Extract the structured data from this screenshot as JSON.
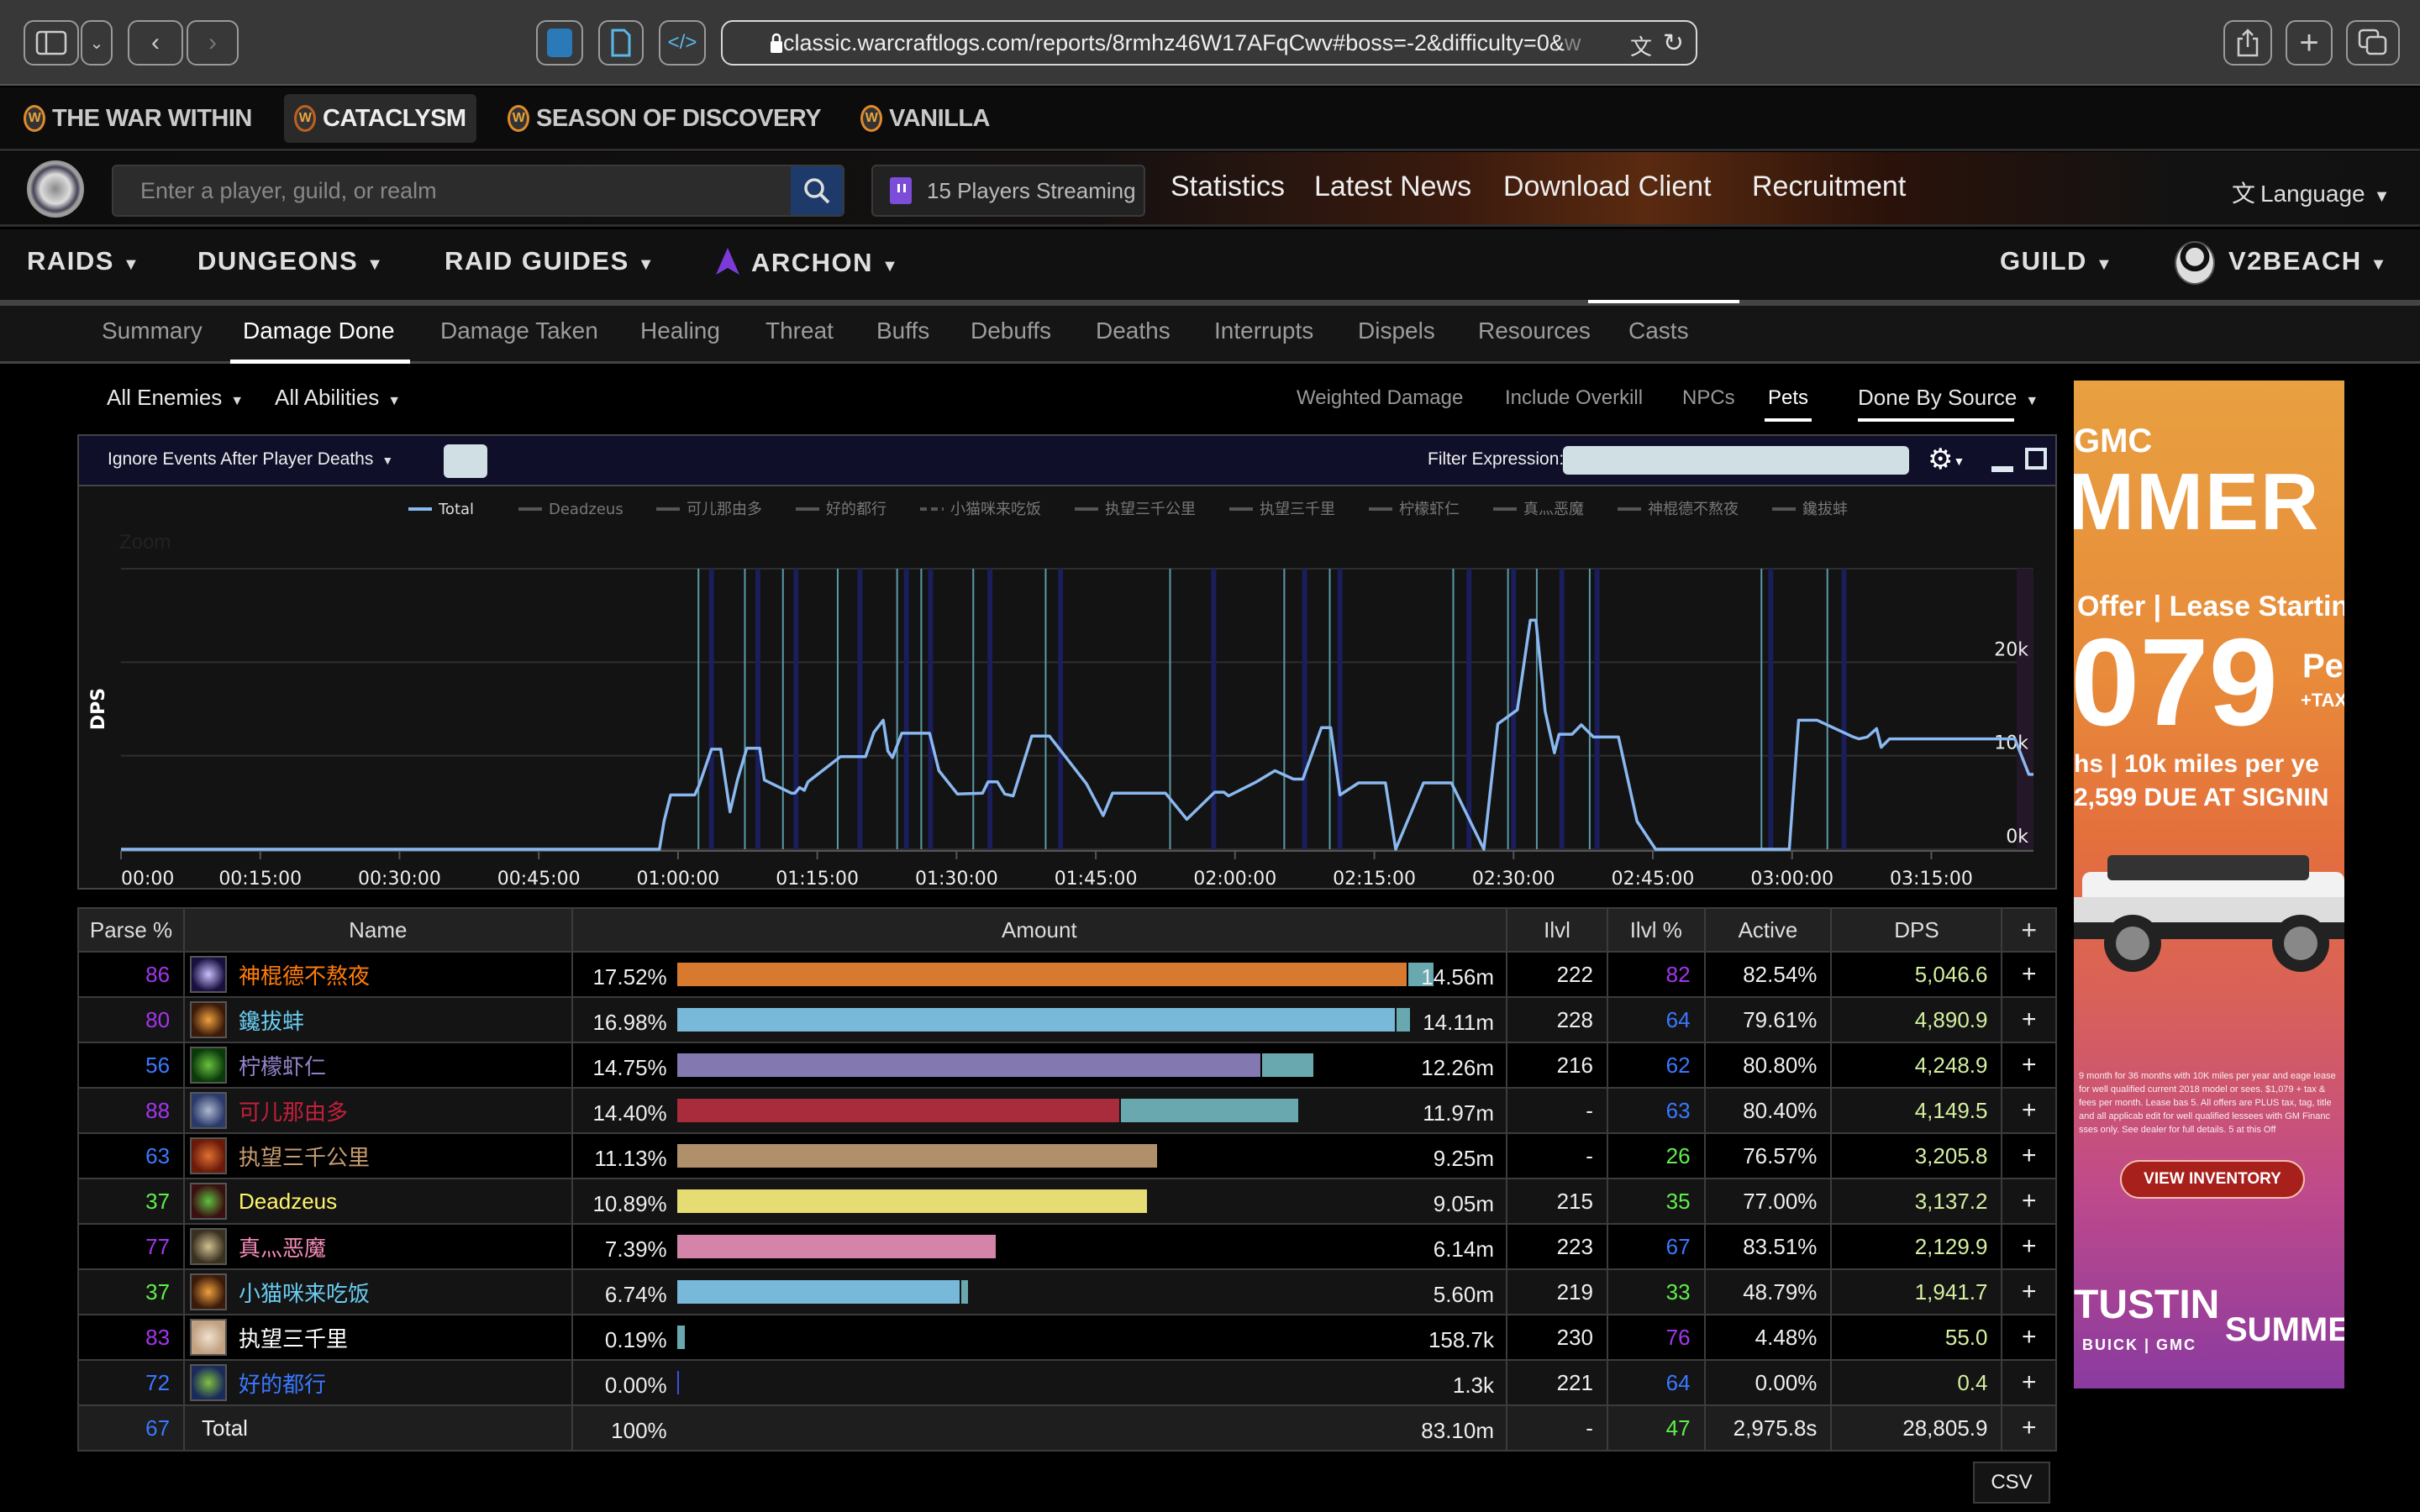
{
  "browser": {
    "url_main": "classic.warcraftlogs.com/reports/8rmhz46W17AFqCwv#boss=-2&difficulty=0&",
    "url_fade": "w",
    "buttons": [
      "sidebar-toggle",
      "tab-overview",
      "back",
      "forward",
      "extension-1",
      "reader",
      "developer",
      "share",
      "new-tab",
      "tab-overview-grid"
    ]
  },
  "game_tabs": [
    {
      "label": "THE WAR WITHIN",
      "active": false
    },
    {
      "label": "CATACLYSM",
      "active": true
    },
    {
      "label": "SEASON OF DISCOVERY",
      "active": false
    },
    {
      "label": "VANILLA",
      "active": false
    }
  ],
  "header": {
    "search_placeholder": "Enter a player, guild, or realm",
    "streaming": "15 Players Streaming",
    "links": [
      "Statistics",
      "Latest News",
      "Download Client",
      "Recruitment"
    ],
    "language": "Language"
  },
  "main_nav": {
    "left": [
      "RAIDS",
      "DUNGEONS",
      "RAID GUIDES",
      "ARCHON"
    ],
    "guild": "GUILD",
    "user": "V2BEACH"
  },
  "report_tabs": {
    "items": [
      "Summary",
      "Damage Done",
      "Damage Taken",
      "Healing",
      "Threat",
      "Buffs",
      "Debuffs",
      "Deaths",
      "Interrupts",
      "Dispels",
      "Resources",
      "Casts"
    ],
    "active": "Damage Done"
  },
  "filters": {
    "enemies": "All Enemies",
    "abilities": "All Abilities",
    "options": [
      {
        "label": "Weighted Damage",
        "active": false
      },
      {
        "label": "Include Overkill",
        "active": false
      },
      {
        "label": "NPCs",
        "active": false
      },
      {
        "label": "Pets",
        "active": true
      }
    ],
    "view": "Done By Source",
    "ignore_events": "Ignore Events After Player Deaths",
    "filter_expression_label": "Filter Expression:",
    "filter_expression_value": ""
  },
  "chart_data": {
    "type": "line",
    "title": "",
    "zoom_label": "Zoom",
    "ylabel": "DPS",
    "xlabel": "",
    "ylim": [
      0,
      24000
    ],
    "yticks": [
      "0k",
      "10k",
      "20k"
    ],
    "ytick_values": [
      0,
      10000,
      20000
    ],
    "xticks": [
      "00:00",
      "00:15:00",
      "00:30:00",
      "00:45:00",
      "01:00:00",
      "01:15:00",
      "01:30:00",
      "01:45:00",
      "02:00:00",
      "02:15:00",
      "02:30:00",
      "02:45:00",
      "03:00:00",
      "03:15:00"
    ],
    "x_range_minutes": [
      0,
      206
    ],
    "legend": [
      "Total",
      "Deadzeus",
      "可儿那由多",
      "好的都行",
      "小猫咪来吃饭",
      "执望三千公里",
      "执望三千里",
      "柠檬虾仁",
      "真灬恶魔",
      "神棍德不熬夜",
      "鑱拔蚌"
    ],
    "legend_active": "Total",
    "legend_placement": "top-center",
    "grid": true,
    "series": [
      {
        "name": "Total",
        "color": "#8ab8f0",
        "x_minutes": [
          0,
          58,
          58.5,
          59.2,
          61.5,
          61.8,
          62.3,
          63.6,
          64.1,
          64.6,
          65.6,
          66.4,
          67.4,
          68.8,
          69.3,
          72.2,
          72.6,
          73.1,
          73.6,
          74,
          77.5,
          78,
          80.2,
          81.1,
          82.1,
          82.6,
          83.1,
          84.1,
          85.1,
          87.1,
          88.1,
          90.1,
          92.8,
          93.4,
          94.4,
          95.2,
          96.1,
          98.1,
          99.1,
          100,
          104,
          105.8,
          106.8,
          107.6,
          112.5,
          114.8,
          117.8,
          118.8,
          119.3,
          122.3,
          124.3,
          126.3,
          127.3,
          129.3,
          130.3,
          131.3,
          133.3,
          136.2,
          137.3,
          140.3,
          141.2,
          143.3,
          146.8,
          148.3,
          150.4,
          151.8,
          152.4,
          153.4,
          154.4,
          154.9,
          156.3,
          157.3,
          158.6,
          159.3,
          161.3,
          163.3,
          165.3,
          166.8,
          173.3,
          179.7,
          180.7,
          182.7,
          186.6,
          187.2,
          188.1,
          189.1,
          189.6,
          190.5,
          191.7,
          195.8,
          196.2,
          198.3,
          199.3,
          200.4,
          201,
          201.5,
          203,
          204,
          205.5,
          206
        ],
        "values": [
          0,
          0,
          3000,
          5800,
          5800,
          5800,
          6900,
          10700,
          10700,
          10700,
          4000,
          7400,
          10800,
          10800,
          7400,
          6000,
          6000,
          6600,
          6300,
          7200,
          9900,
          9900,
          9900,
          12500,
          13800,
          10500,
          9800,
          12400,
          12400,
          12400,
          8400,
          5900,
          6000,
          7200,
          7200,
          5900,
          5700,
          12100,
          12100,
          12100,
          7000,
          3600,
          6000,
          6000,
          6000,
          3200,
          6100,
          6100,
          5700,
          7200,
          8400,
          7500,
          7500,
          13000,
          13000,
          5800,
          7100,
          7100,
          0,
          7100,
          7100,
          7100,
          0,
          13400,
          14900,
          24500,
          24500,
          14800,
          10300,
          12300,
          12300,
          13300,
          12000,
          12000,
          12000,
          3000,
          0,
          0,
          0,
          0,
          13800,
          13800,
          12000,
          11800,
          12000,
          12900,
          10900,
          11800,
          11800,
          11800,
          11800,
          11800,
          11800,
          11800,
          11800,
          11800,
          11800,
          11800,
          8000,
          8000
        ]
      }
    ],
    "event_markers_minutes": [
      62.2,
      63.6,
      67.2,
      68.6,
      71.3,
      72.7,
      77.2,
      79.6,
      83.6,
      84.6,
      86.2,
      87.2,
      91.8,
      93.6,
      99.6,
      101.2,
      113,
      117.7,
      125.3,
      127.5,
      130.2,
      131.3,
      143.5,
      145.2,
      149.4,
      150,
      152.5,
      155.2,
      158.2,
      159,
      176.7,
      177.7,
      183.8,
      185.6
    ],
    "marker_colors": {
      "thin": "#5a9aa8",
      "thick": "#1a1e5a"
    }
  },
  "table": {
    "headers": [
      "Parse %",
      "Name",
      "Amount",
      "Ilvl",
      "Ilvl %",
      "Active",
      "DPS",
      "+"
    ],
    "max_amount_pct": 17.52,
    "rows": [
      {
        "parse": "86",
        "parse_color": "#a335ee",
        "name": "神棍德不熬夜",
        "name_color": "#ff7d0a",
        "icon_colors": [
          "#1a1040",
          "#c8c0ff"
        ],
        "pct": "17.52%",
        "pct_value": 17.52,
        "bar_color": "#d77a30",
        "pet_share": 0.035,
        "amount": "14.56m",
        "ilvl": "222",
        "ilvl_pct": "82",
        "ilvl_pct_color": "#a335ee",
        "active": "82.54%",
        "dps": "5,046.6"
      },
      {
        "parse": "80",
        "parse_color": "#a335ee",
        "name": "鑱拔蚌",
        "name_color": "#69ccf0",
        "icon_colors": [
          "#3a1a08",
          "#f0a040"
        ],
        "pct": "16.98%",
        "pct_value": 16.98,
        "bar_color": "#78b8d8",
        "pet_share": 0.02,
        "amount": "14.11m",
        "ilvl": "228",
        "ilvl_pct": "64",
        "ilvl_pct_color": "#3a78ff",
        "active": "79.61%",
        "dps": "4,890.9"
      },
      {
        "parse": "56",
        "parse_color": "#3a78ff",
        "name": "柠檬虾仁",
        "name_color": "#9482c9",
        "icon_colors": [
          "#0a3a0a",
          "#6ac040"
        ],
        "pct": "14.75%",
        "pct_value": 14.75,
        "bar_color": "#8478b0",
        "pet_share": 0.083,
        "amount": "12.26m",
        "ilvl": "216",
        "ilvl_pct": "62",
        "ilvl_pct_color": "#3a78ff",
        "active": "80.80%",
        "dps": "4,248.9"
      },
      {
        "parse": "88",
        "parse_color": "#a335ee",
        "name": "可儿那由多",
        "name_color": "#c41f3b",
        "icon_colors": [
          "#2a3a6a",
          "#b0b8d0"
        ],
        "pct": "14.40%",
        "pct_value": 14.4,
        "bar_color": "#a82c3c",
        "pet_share": 0.288,
        "amount": "11.97m",
        "ilvl": "-",
        "ilvl_pct": "63",
        "ilvl_pct_color": "#3a78ff",
        "active": "80.40%",
        "dps": "4,149.5"
      },
      {
        "parse": "63",
        "parse_color": "#3a78ff",
        "name": "执望三千公里",
        "name_color": "#c79c6e",
        "icon_colors": [
          "#6a1a0a",
          "#e07030"
        ],
        "pct": "11.13%",
        "pct_value": 11.13,
        "bar_color": "#b0906a",
        "pet_share": 0,
        "amount": "9.25m",
        "ilvl": "-",
        "ilvl_pct": "26",
        "ilvl_pct_color": "#5ef04a",
        "active": "76.57%",
        "dps": "3,205.8"
      },
      {
        "parse": "37",
        "parse_color": "#5ef04a",
        "name": "Deadzeus",
        "name_color": "#fff569",
        "icon_colors": [
          "#3a1010",
          "#60c040"
        ],
        "pct": "10.89%",
        "pct_value": 10.89,
        "bar_color": "#e6dc74",
        "pet_share": 0,
        "amount": "9.05m",
        "ilvl": "215",
        "ilvl_pct": "35",
        "ilvl_pct_color": "#5ef04a",
        "active": "77.00%",
        "dps": "3,137.2"
      },
      {
        "parse": "77",
        "parse_color": "#a335ee",
        "name": "真灬恶魔",
        "name_color": "#f58cba",
        "icon_colors": [
          "#3a3020",
          "#d0c090"
        ],
        "pct": "7.39%",
        "pct_value": 7.39,
        "bar_color": "#d484a8",
        "pet_share": 0,
        "amount": "6.14m",
        "ilvl": "223",
        "ilvl_pct": "67",
        "ilvl_pct_color": "#3a78ff",
        "active": "83.51%",
        "dps": "2,129.9"
      },
      {
        "parse": "37",
        "parse_color": "#5ef04a",
        "name": "小猫咪来吃饭",
        "name_color": "#69ccf0",
        "icon_colors": [
          "#3a1a08",
          "#f0a040"
        ],
        "pct": "6.74%",
        "pct_value": 6.74,
        "bar_color": "#78b8d8",
        "pet_share": 0.028,
        "amount": "5.60m",
        "ilvl": "219",
        "ilvl_pct": "33",
        "ilvl_pct_color": "#5ef04a",
        "active": "48.79%",
        "dps": "1,941.7"
      },
      {
        "parse": "83",
        "parse_color": "#a335ee",
        "name": "执望三千里",
        "name_color": "#ffffff",
        "icon_colors": [
          "#c0a080",
          "#f0e0d0"
        ],
        "pct": "0.19%",
        "pct_value": 0.19,
        "bar_color": "#6aa8b0",
        "pet_share": 1,
        "amount": "158.7k",
        "ilvl": "230",
        "ilvl_pct": "76",
        "ilvl_pct_color": "#a335ee",
        "active": "4.48%",
        "dps": "55.0"
      },
      {
        "parse": "72",
        "parse_color": "#3a78ff",
        "name": "好的都行",
        "name_color": "#3a78ff",
        "icon_colors": [
          "#1a2a5a",
          "#80c040"
        ],
        "pct": "0.00%",
        "pct_value": 0.0,
        "bar_color": "#3a50e0",
        "pet_share": 0,
        "amount": "1.3k",
        "ilvl": "221",
        "ilvl_pct": "64",
        "ilvl_pct_color": "#3a78ff",
        "active": "0.00%",
        "dps": "0.4"
      }
    ],
    "total": {
      "parse": "67",
      "parse_color": "#3a78ff",
      "name": "Total",
      "pct": "100%",
      "amount": "83.10m",
      "ilvl": "-",
      "ilvl_pct": "47",
      "ilvl_pct_color": "#5ef04a",
      "active": "2,975.8s",
      "dps": "28,805.9"
    },
    "pet_bar_color": "#6aa8b0",
    "dps_color": "#d4f0a0",
    "csv_label": "CSV"
  },
  "ad": {
    "brand_top": "GMC",
    "headline": "MMER",
    "offer": "Offer | Lease Startin",
    "price": "079",
    "per": "Pe",
    "tax": "+TAX",
    "terms": "hs | 10k miles per ye",
    "due": "2,599 DUE AT SIGNIN",
    "fine_print": "9 month for 36 months with 10K miles per year and eage lease for well qualified current 2018 model or sees. $1,079 + tax & fees per month. Lease bas 5. All offers are PLUS tax, tag, title and all applicab edit for well qualified lessees with GM Financ sses only. See dealer for full details. 5 at this Off",
    "cta": "VIEW INVENTORY",
    "dealer": "TUSTIN",
    "dealer_sub": "BUICK | GMC",
    "event": "SUMMER S"
  }
}
